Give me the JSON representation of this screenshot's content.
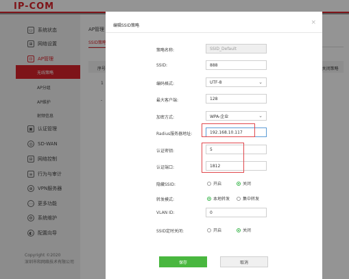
{
  "brand": {
    "logo": "IP-COM"
  },
  "sidebar": {
    "items": [
      {
        "label": "系统状态",
        "icon": "monitor-icon"
      },
      {
        "label": "网络设置",
        "icon": "network-icon"
      },
      {
        "label": "AP管理",
        "icon": "ap-icon"
      },
      {
        "label": "认证管理",
        "icon": "auth-icon"
      },
      {
        "label": "SD-WAN",
        "icon": "sdwan-icon"
      },
      {
        "label": "网络控制",
        "icon": "control-icon"
      },
      {
        "label": "行为与审计",
        "icon": "audit-icon"
      },
      {
        "label": "VPN服务器",
        "icon": "vpn-icon"
      },
      {
        "label": "更多功能",
        "icon": "more-icon"
      },
      {
        "label": "系统维护",
        "icon": "maintenance-icon"
      },
      {
        "label": "配置向导",
        "icon": "wizard-icon"
      }
    ],
    "sub_items": [
      {
        "label": "无线策略"
      },
      {
        "label": "AP分组"
      },
      {
        "label": "AP维护"
      },
      {
        "label": "射频信息"
      }
    ],
    "copyright_line1": "Copyright ©2020",
    "copyright_line2": "深圳市和网络技术有限公司"
  },
  "content": {
    "breadcrumb": "AP管理 -",
    "subtab": "SSID策略",
    "col_first": "序号",
    "col_last": "D关闭策略",
    "row1": "1",
    "row2": "-"
  },
  "modal": {
    "title": "编辑SSID策略",
    "close": "×",
    "fields": {
      "policy_name": {
        "label": "策略名称:",
        "value": "SSID_Default"
      },
      "ssid": {
        "label": "SSID:",
        "value": "888"
      },
      "encoding": {
        "label": "编码格式:",
        "value": "UTF-8"
      },
      "max_clients": {
        "label": "最大客户端:",
        "value": "128"
      },
      "encryption": {
        "label": "加密方式:",
        "value": "WPA-企业"
      },
      "radius_addr": {
        "label": "Radius服务器地址:",
        "value": "192.168.10.117"
      },
      "auth_key": {
        "label": "认证密钥:",
        "value": "5"
      },
      "auth_port": {
        "label": "认证端口:",
        "value": "1812"
      },
      "hide_ssid": {
        "label": "隐藏SSID:",
        "opt_on": "开启",
        "opt_off": "关闭",
        "selected": "off"
      },
      "forward_mode": {
        "label": "转发模式:",
        "opt_local": "本地转发",
        "opt_central": "集中转发",
        "selected": "local"
      },
      "vlan_id": {
        "label": "VLAN ID:",
        "value": "0"
      },
      "ssid_schedule": {
        "label": "SSID定时关闭:",
        "opt_on": "开启",
        "opt_off": "关闭",
        "selected": "off"
      }
    },
    "save_label": "保存",
    "cancel_label": "取消"
  },
  "colors": {
    "brand_red": "#d9242b",
    "save_green": "#49b73f",
    "radio_green": "#39b54a",
    "highlight_red": "#e0454a"
  }
}
